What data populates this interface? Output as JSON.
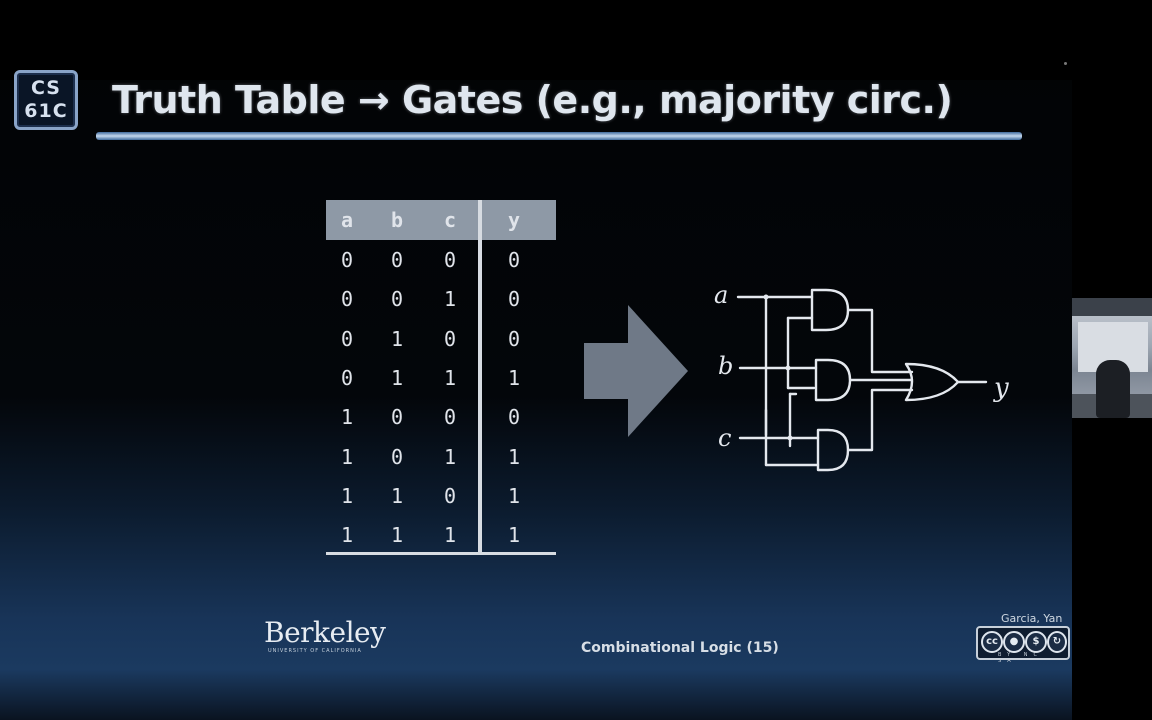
{
  "slide": {
    "logo": {
      "line1": "CS",
      "line2": "61C"
    },
    "title": "Truth Table → Gates (e.g., majority circ.)",
    "truth_table": {
      "headers": [
        "a",
        "b",
        "c",
        "y"
      ],
      "rows": [
        [
          "0",
          "0",
          "0",
          "0"
        ],
        [
          "0",
          "0",
          "1",
          "0"
        ],
        [
          "0",
          "1",
          "0",
          "0"
        ],
        [
          "0",
          "1",
          "1",
          "1"
        ],
        [
          "1",
          "0",
          "0",
          "0"
        ],
        [
          "1",
          "0",
          "1",
          "1"
        ],
        [
          "1",
          "1",
          "0",
          "1"
        ],
        [
          "1",
          "1",
          "1",
          "1"
        ]
      ]
    },
    "circuit": {
      "inputs": [
        "a",
        "b",
        "c"
      ],
      "output": "y"
    },
    "footer": {
      "university": "Berkeley",
      "university_sub": "UNIVERSITY OF CALIFORNIA",
      "center": "Combinational Logic (15)",
      "authors": "Garcia, Yan",
      "license_labels": "BY NC SA"
    }
  }
}
